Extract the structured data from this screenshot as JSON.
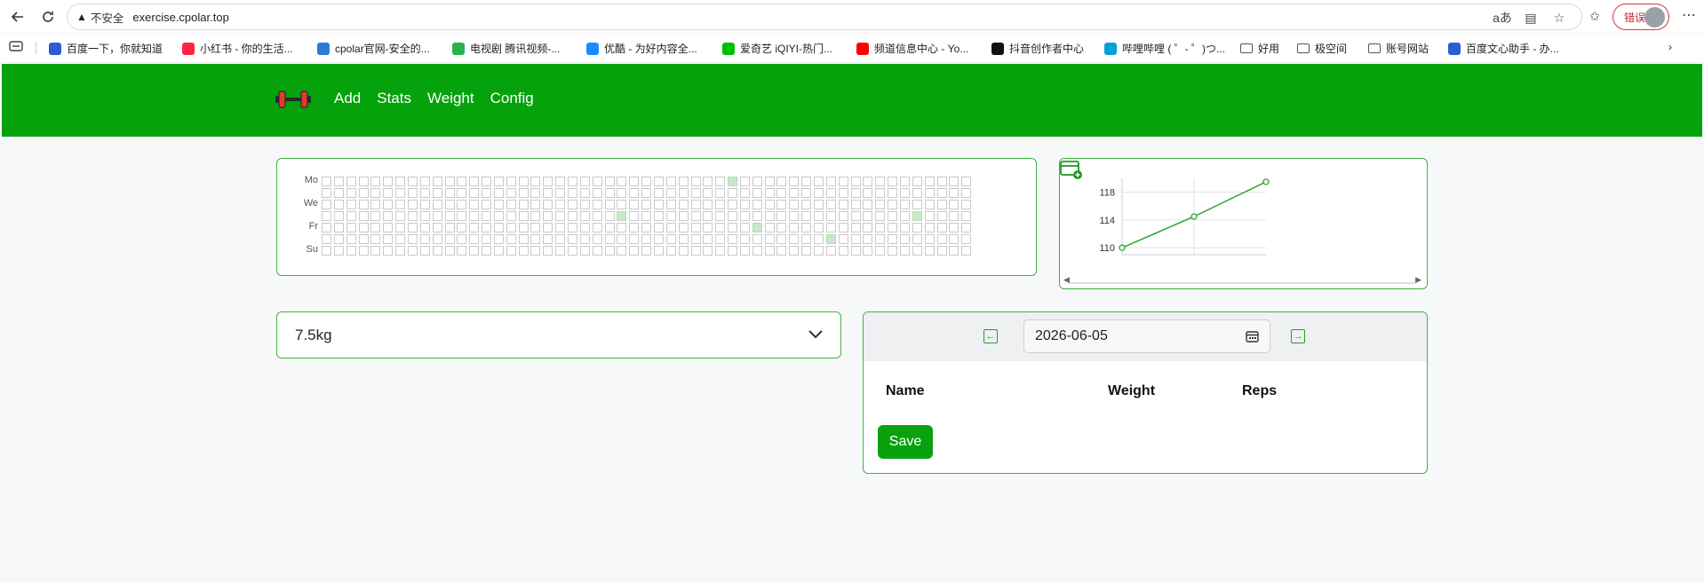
{
  "browser": {
    "insecure_label": "不安全",
    "url": "exercise.cpolar.top",
    "error_label": "错误",
    "bookmarks": [
      {
        "label": "百度一下，你就知道",
        "color": "#2b5bd6"
      },
      {
        "label": "小红书 - 你的生活...",
        "color": "#ff2442"
      },
      {
        "label": "cpolar官网-安全的...",
        "color": "#2b7bd6"
      },
      {
        "label": "电视剧 腾讯视频-...",
        "color": "#27b24a"
      },
      {
        "label": "优酷 - 为好内容全...",
        "color": "#1a8cff"
      },
      {
        "label": "爱奇艺 iQIYI-热门...",
        "color": "#00be06"
      },
      {
        "label": "频道信息中心 - Yo...",
        "color": "#ff0000"
      },
      {
        "label": "抖音创作者中心",
        "color": "#111111"
      },
      {
        "label": "哔哩哔哩 ( ゜- ゜)つ...",
        "color": "#00a1d6"
      },
      {
        "label": "好用",
        "color": "folder"
      },
      {
        "label": "极空间",
        "color": "folder"
      },
      {
        "label": "账号网站",
        "color": "folder"
      },
      {
        "label": "百度文心助手 - 办...",
        "color": "#2b5bd6"
      }
    ]
  },
  "header": {
    "nav": [
      "Add",
      "Stats",
      "Weight",
      "Config"
    ],
    "brand_color": "#05a20b"
  },
  "heatmap": {
    "day_labels": [
      "Mo",
      "We",
      "Fr",
      "Su"
    ],
    "weeks": 53,
    "active_cells": [
      [
        33,
        0
      ],
      [
        24,
        3
      ],
      [
        35,
        4
      ],
      [
        48,
        3
      ],
      [
        41,
        5
      ]
    ]
  },
  "weight_chart": {
    "y_ticks": [
      "118",
      "114",
      "110"
    ],
    "points": [
      110,
      114.5,
      119.5
    ]
  },
  "select": {
    "value": "7.5kg"
  },
  "exercise_panel": {
    "date": "2026-06-05",
    "columns": [
      "Name",
      "Weight",
      "Reps"
    ],
    "save_label": "Save"
  }
}
